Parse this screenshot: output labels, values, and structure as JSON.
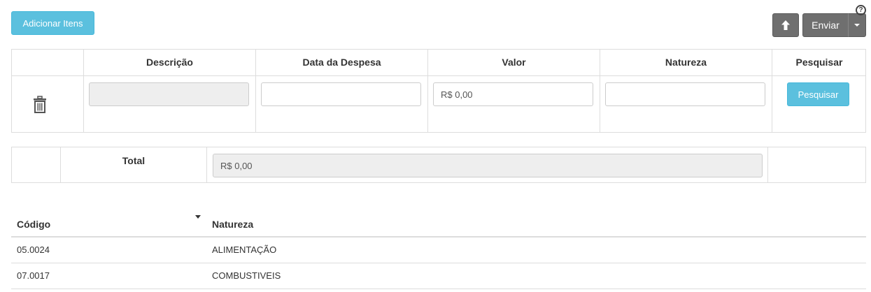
{
  "toolbar": {
    "add_items_label": "Adicionar Itens",
    "send_label": "Enviar",
    "help_icon": "?"
  },
  "items_table": {
    "headers": [
      "Descrição",
      "Data da Despesa",
      "Valor",
      "Natureza",
      "Pesquisar"
    ],
    "row": {
      "descricao": "",
      "data": "",
      "valor": "R$ 0,00",
      "natureza": "",
      "search_button": "Pesquisar"
    }
  },
  "total": {
    "label": "Total",
    "value": "R$ 0,00"
  },
  "natureza_list": {
    "headers": {
      "codigo": "Código",
      "natureza": "Natureza"
    },
    "rows": [
      {
        "codigo": "05.0024",
        "natureza": "ALIMENTAÇÃO"
      },
      {
        "codigo": "07.0017",
        "natureza": "COMBUSTIVEIS"
      }
    ]
  }
}
